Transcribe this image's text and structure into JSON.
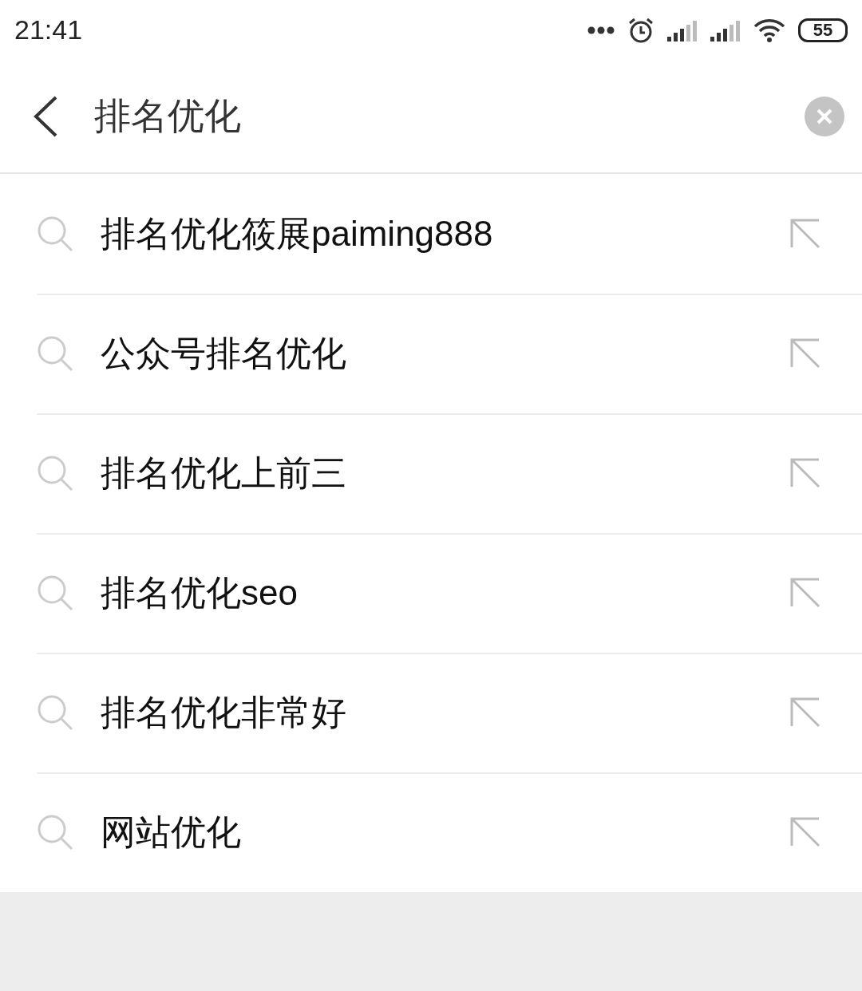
{
  "status_bar": {
    "time": "21:41",
    "battery": "55"
  },
  "search": {
    "value": "排名优化"
  },
  "suggestions": [
    {
      "text": "排名优化筱展paiming888"
    },
    {
      "text": "公众号排名优化"
    },
    {
      "text": "排名优化上前三"
    },
    {
      "text": "排名优化seo"
    },
    {
      "text": "排名优化非常好"
    },
    {
      "text": "网站优化"
    }
  ]
}
